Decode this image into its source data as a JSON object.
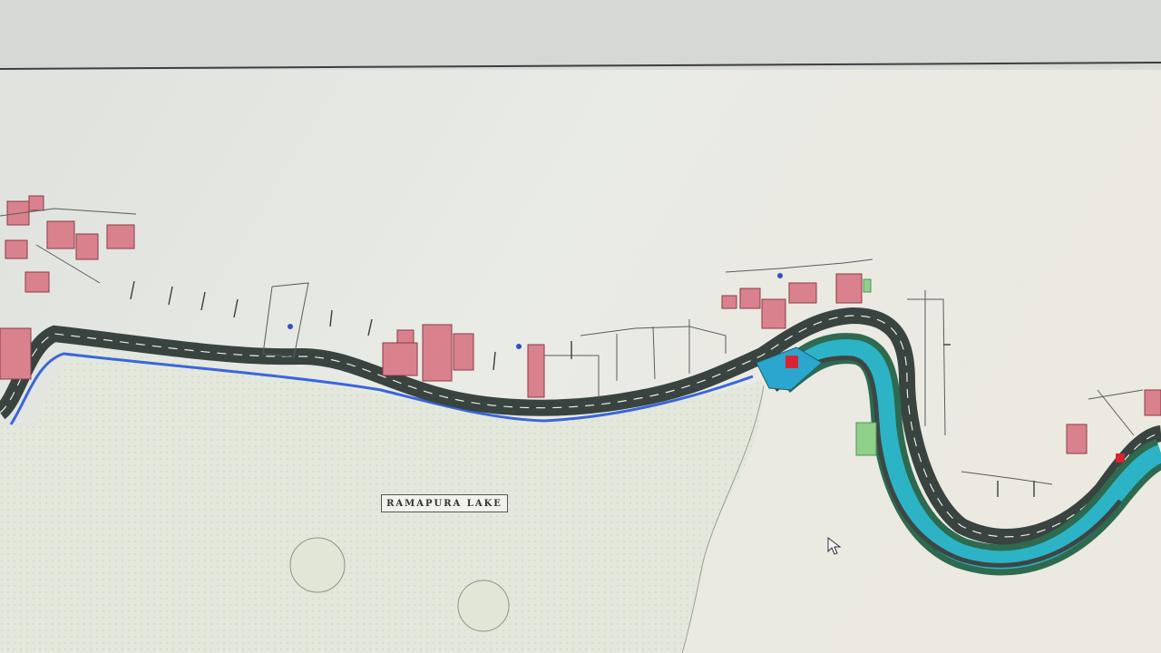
{
  "map": {
    "lake_label": "RAMAPURA LAKE"
  },
  "colors": {
    "paper": "#eceee6",
    "lake_fill": "#e7eadf",
    "road": "#3d4744",
    "road_edge_blue": "#2f5fd9",
    "channel": "#2bb5c9",
    "channel_bank": "#2f6a52",
    "building": "#d9828d",
    "building_outline": "#8a3a45",
    "green_plot": "#8fd08a",
    "red_marker": "#d82432"
  },
  "icons": {
    "cursor": "mouse-pointer-icon"
  }
}
